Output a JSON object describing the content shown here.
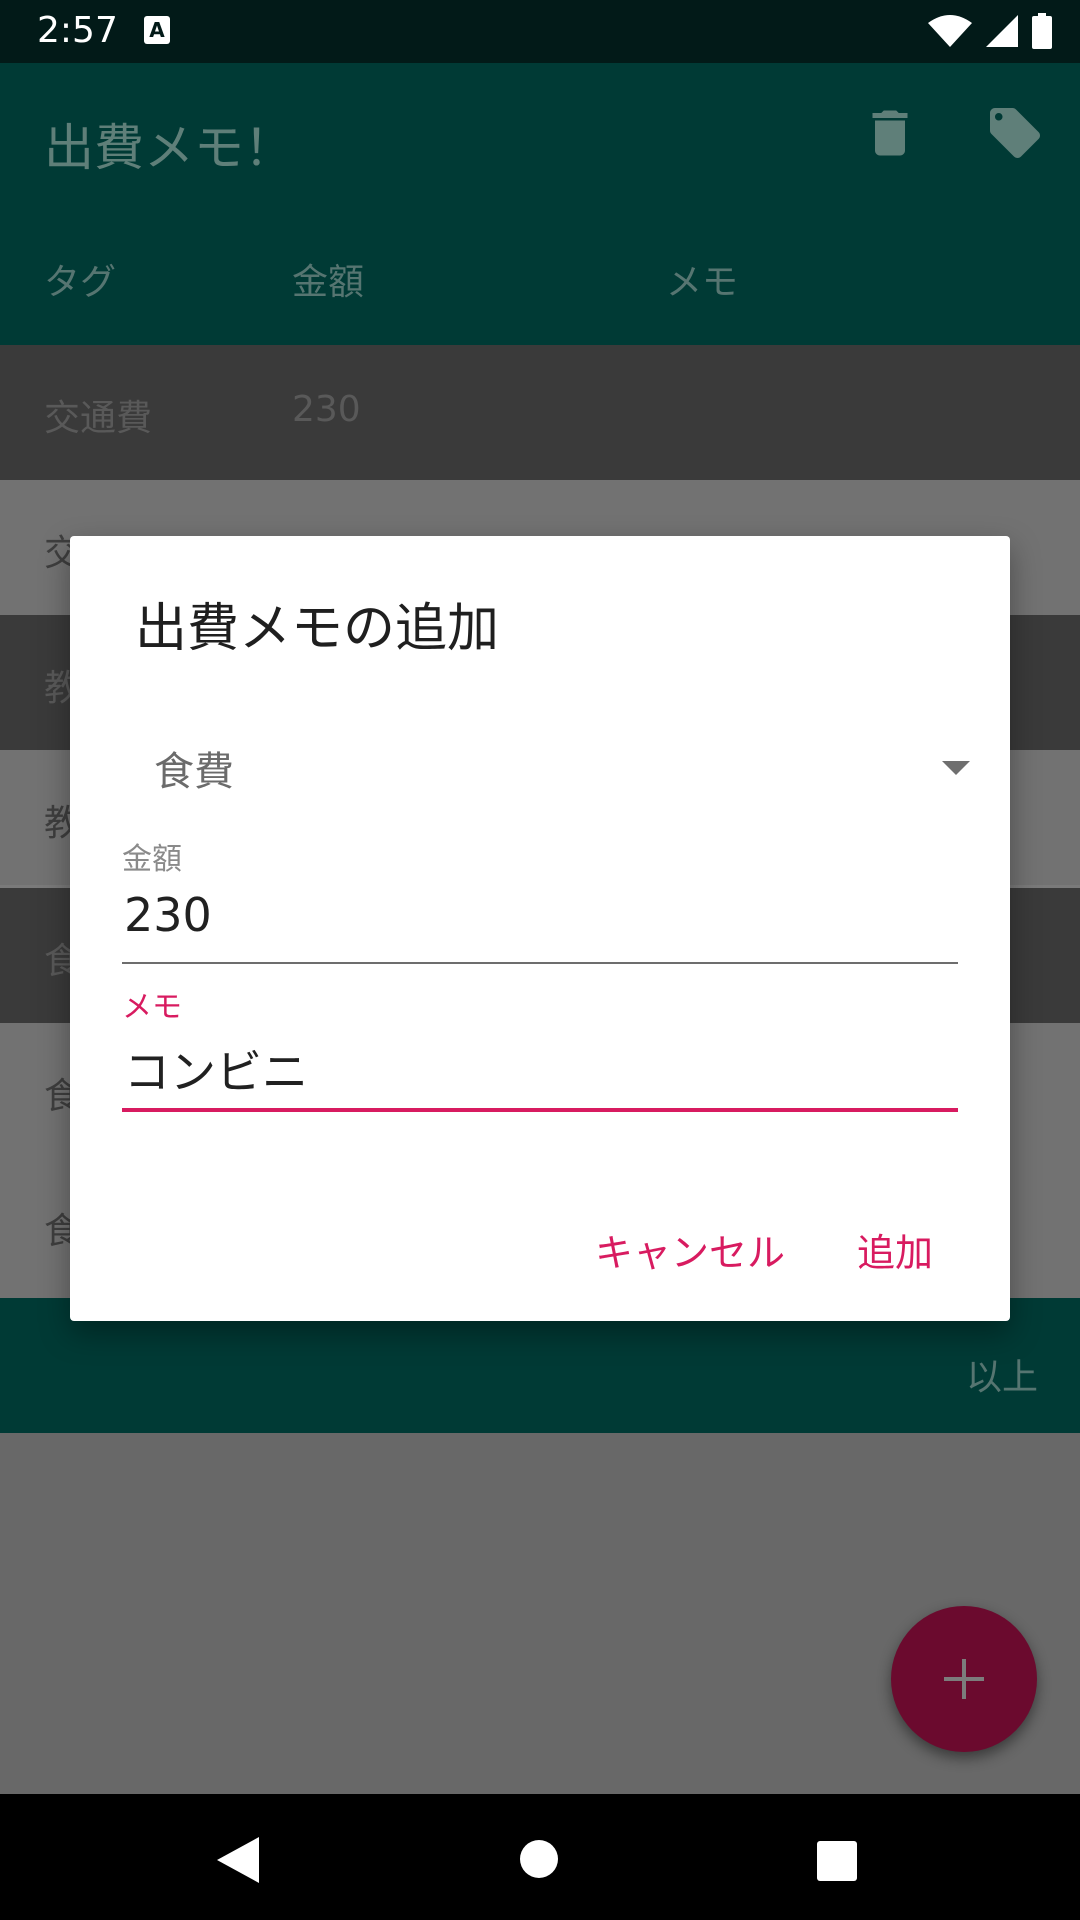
{
  "status_bar": {
    "time": "2:57",
    "notification_icon": "A"
  },
  "app_bar": {
    "title": "出費メモ！",
    "actions": [
      "trash-icon",
      "tag-icon"
    ]
  },
  "table": {
    "headers": [
      "タグ",
      "金額",
      "メモ"
    ],
    "rows": [
      {
        "tag": "交通費",
        "amount": "230",
        "memo": ""
      },
      {
        "tag": "交",
        "amount": "",
        "memo": ""
      },
      {
        "tag": "教",
        "amount": "",
        "memo": ""
      },
      {
        "tag": "教",
        "amount": "",
        "memo": ""
      },
      {
        "tag": "食",
        "amount": "",
        "memo": ""
      },
      {
        "tag": "食",
        "amount": "",
        "memo": ""
      },
      {
        "tag": "食",
        "amount": "",
        "memo": ""
      }
    ],
    "footer": "以上"
  },
  "dialog": {
    "title": "出費メモの追加",
    "tag_select": {
      "value": "食費"
    },
    "amount": {
      "label": "金額",
      "value": "230"
    },
    "memo": {
      "label": "メモ",
      "value": "コンビニ"
    },
    "cancel_label": "キャンセル",
    "add_label": "追加"
  },
  "fab": {
    "icon": "plus-icon"
  },
  "colors": {
    "accent": "#d81b60",
    "primary_dark": "#003a35",
    "status_bar": "#021a18"
  }
}
